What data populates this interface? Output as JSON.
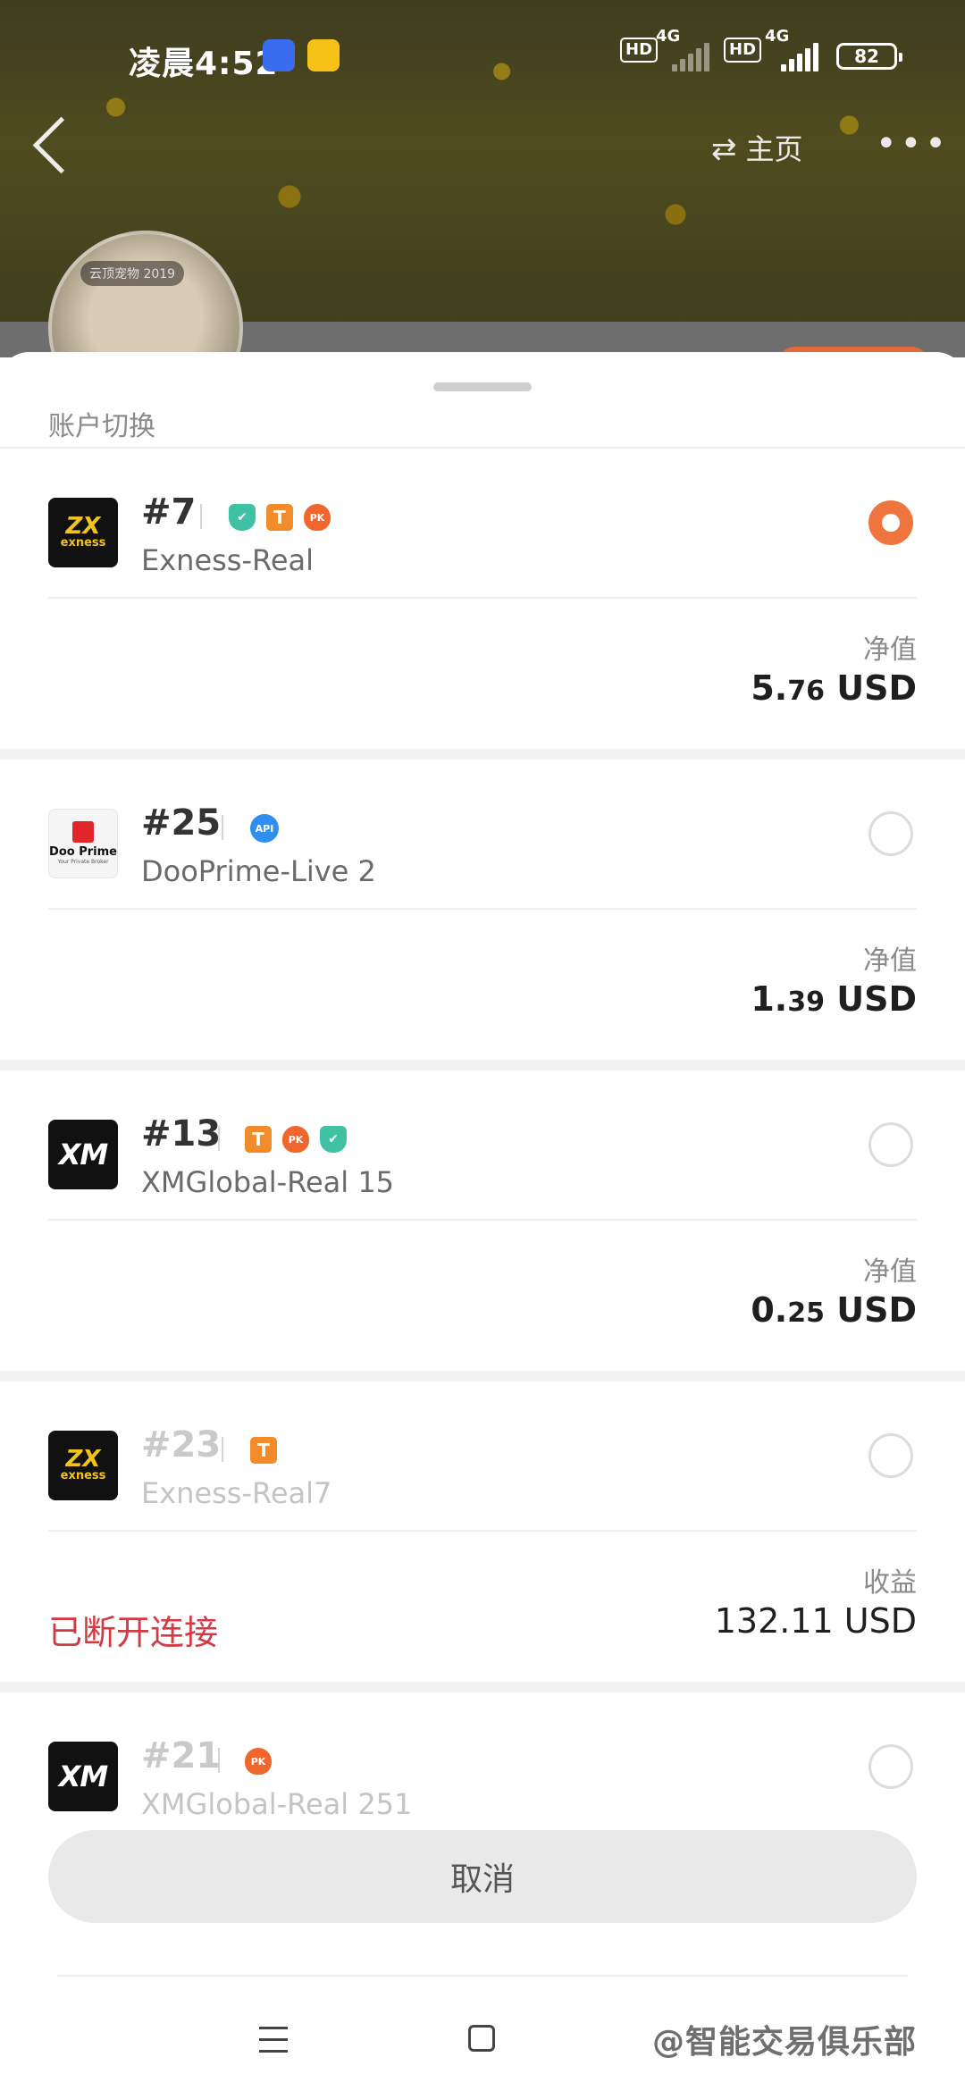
{
  "status_bar": {
    "time": "凌晨4:52",
    "network_1": "4G",
    "network_2": "4G",
    "hd_1": "HD",
    "hd_2": "HD",
    "battery": "82"
  },
  "header": {
    "home_label": "主页",
    "avatar_tag": "云顶宠物 2019"
  },
  "sheet": {
    "title": "账户切换",
    "cancel_label": "取消"
  },
  "accounts": [
    {
      "number": "#7",
      "server": "Exness-Real",
      "broker_logo": "exness-logo",
      "badges": [
        "shield-icon",
        "t-icon",
        "pk-icon"
      ],
      "selected": true,
      "value_label": "净值",
      "value_main": "5.",
      "value_small": "76",
      "value_unit": " USD",
      "status": ""
    },
    {
      "number": "#25",
      "server": "DooPrime-Live 2",
      "broker_logo": "dooprime-logo",
      "badges": [
        "api-icon"
      ],
      "selected": false,
      "value_label": "净值",
      "value_main": "1.",
      "value_small": "39",
      "value_unit": " USD",
      "status": ""
    },
    {
      "number": "#13",
      "server": "XMGlobal-Real 15",
      "broker_logo": "xm-logo",
      "badges": [
        "t-icon",
        "pk-icon",
        "shield-icon"
      ],
      "selected": false,
      "value_label": "净值",
      "value_main": "0.",
      "value_small": "25",
      "value_unit": " USD",
      "status": ""
    },
    {
      "number": "#23",
      "server": "Exness-Real7",
      "broker_logo": "exness-logo",
      "badges": [
        "t-icon"
      ],
      "selected": false,
      "value_label": "收益",
      "value_full": "132.11 USD",
      "status": "已断开连接"
    },
    {
      "number": "#21",
      "server": "XMGlobal-Real 251",
      "broker_logo": "xm-logo",
      "badges": [
        "pk-icon"
      ],
      "selected": false
    }
  ],
  "badge_text": {
    "t": "T",
    "pk": "PK",
    "api": "API",
    "shield": "✔"
  },
  "logo_text": {
    "exness_mark": "ZX",
    "exness_word": "exness",
    "doo_word": "Doo Prime",
    "doo_sub": "Your Private Broker",
    "xm_word": "XM"
  },
  "watermark": "@智能交易俱乐部",
  "colors": {
    "accent": "#f0743e",
    "disconnected": "#d23b45"
  }
}
